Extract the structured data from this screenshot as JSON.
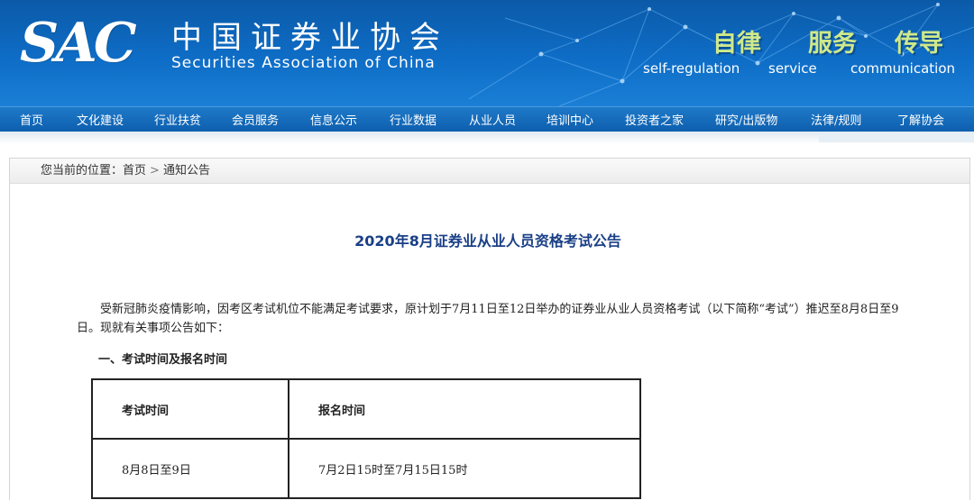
{
  "header": {
    "logo": "SAC",
    "org_cn": "中国证券业协会",
    "org_en": "Securities Association of China",
    "slogans": [
      {
        "cn": "自律",
        "en": "self-regulation"
      },
      {
        "cn": "服务",
        "en": "service"
      },
      {
        "cn": "传导",
        "en": "communication"
      }
    ]
  },
  "nav": {
    "items": [
      "首页",
      "文化建设",
      "行业扶贫",
      "会员服务",
      "信息公示",
      "行业数据",
      "从业人员",
      "培训中心",
      "投资者之家",
      "研究/出版物",
      "法律/规则",
      "了解协会"
    ]
  },
  "breadcrumb": {
    "prefix": "您当前的位置：",
    "home": "首页",
    "separator": ">",
    "current": "通知公告"
  },
  "article": {
    "title": "2020年8月证券业从业人员资格考试公告",
    "intro": "受新冠肺炎疫情影响，因考区考试机位不能满足考试要求，原计划于7月11日至12日举办的证券业从业人员资格考试（以下简称“考试”）推迟至8月8日至9日。现就有关事项公告如下：",
    "section1": "一、考试时间及报名时间",
    "table": {
      "headers": [
        "考试时间",
        "报名时间"
      ],
      "rows": [
        [
          "8月8日至9日",
          "7月2日15时至7月15日15时"
        ]
      ]
    }
  },
  "colors": {
    "banner": "#0e6dc6",
    "nav": "#1169b8",
    "title": "#1a3f86",
    "slogan": "#cfe98a"
  }
}
